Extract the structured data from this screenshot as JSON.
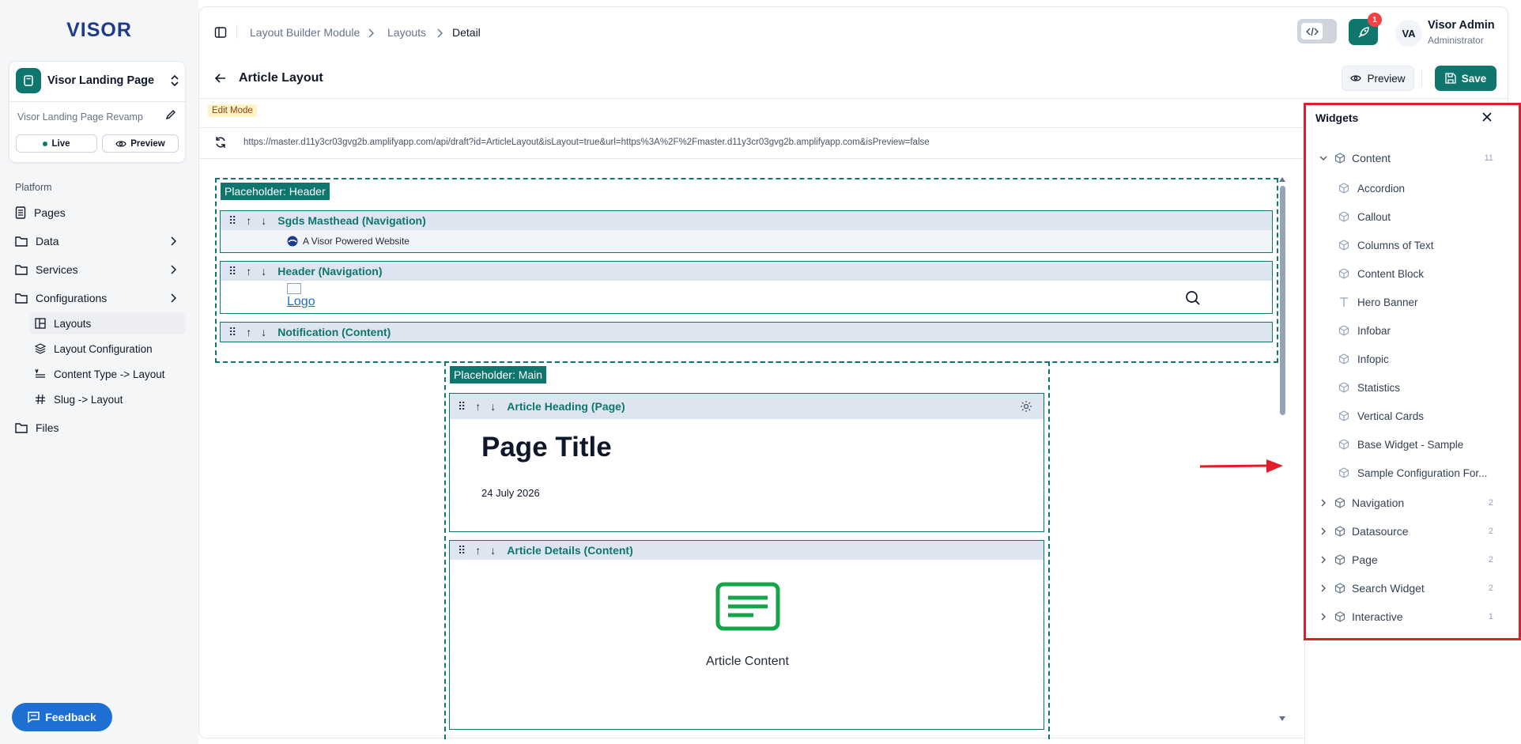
{
  "sidebar": {
    "logo": "VISOR",
    "site": {
      "name": "Visor Landing Page",
      "subtitle": "Visor Landing Page Revamp",
      "live_label": "Live",
      "preview_label": "Preview"
    },
    "section_label": "Platform",
    "items": [
      {
        "label": "Pages",
        "icon": "document-icon"
      },
      {
        "label": "Data",
        "icon": "folder-icon"
      },
      {
        "label": "Services",
        "icon": "folder-icon"
      },
      {
        "label": "Configurations",
        "icon": "folder-icon"
      }
    ],
    "sub_items": [
      {
        "label": "Layouts",
        "icon": "layout-icon",
        "active": true
      },
      {
        "label": "Layout Configuration",
        "icon": "layers-icon"
      },
      {
        "label": "Content Type -> Layout",
        "icon": "text-align-icon"
      },
      {
        "label": "Slug -> Layout",
        "icon": "hash-icon"
      }
    ],
    "files_label": "Files",
    "feedback_label": "Feedback"
  },
  "header": {
    "breadcrumbs": [
      "Layout Builder Module",
      "Layouts",
      "Detail"
    ],
    "notification_count": "1",
    "user": {
      "initials": "VA",
      "name": "Visor Admin",
      "role": "Administrator"
    }
  },
  "page": {
    "title": "Article Layout",
    "preview_label": "Preview",
    "save_label": "Save",
    "mode_label": "Edit Mode"
  },
  "url": "https://master.d11y3cr03gvg2b.amplifyapp.com/api/draft?id=ArticleLayout&isLayout=true&url=https%3A%2F%2Fmaster.d11y3cr03gvg2b.amplifyapp.com&isPreview=false",
  "canvas": {
    "header_placeholder": "Placeholder: Header",
    "masthead": {
      "name": "Sgds Masthead (Navigation)",
      "text": "A Visor Powered Website"
    },
    "header_widget": {
      "name": "Header (Navigation)",
      "logo_alt": "Logo"
    },
    "notification": {
      "name": "Notification (Content)"
    },
    "main_placeholder": "Placeholder: Main",
    "article_heading": {
      "name": "Article Heading (Page)",
      "title": "Page Title",
      "date": "24 July 2026"
    },
    "article_details": {
      "name": "Article Details (Content)",
      "content_label": "Article Content"
    }
  },
  "widgets_panel": {
    "title": "Widgets",
    "categories": [
      {
        "label": "Content",
        "count": "11",
        "expanded": true,
        "items": [
          "Accordion",
          "Callout",
          "Columns of Text",
          "Content Block",
          "Hero Banner",
          "Infobar",
          "Infopic",
          "Statistics",
          "Vertical Cards",
          "Base Widget - Sample",
          "Sample Configuration For..."
        ]
      },
      {
        "label": "Navigation",
        "count": "2"
      },
      {
        "label": "Datasource",
        "count": "2"
      },
      {
        "label": "Page",
        "count": "2"
      },
      {
        "label": "Search Widget",
        "count": "2"
      },
      {
        "label": "Interactive",
        "count": "1"
      }
    ]
  },
  "colors": {
    "accent": "#0f766e",
    "annotation_red": "#e11d2a",
    "feedback_blue": "#1d6fd1"
  }
}
